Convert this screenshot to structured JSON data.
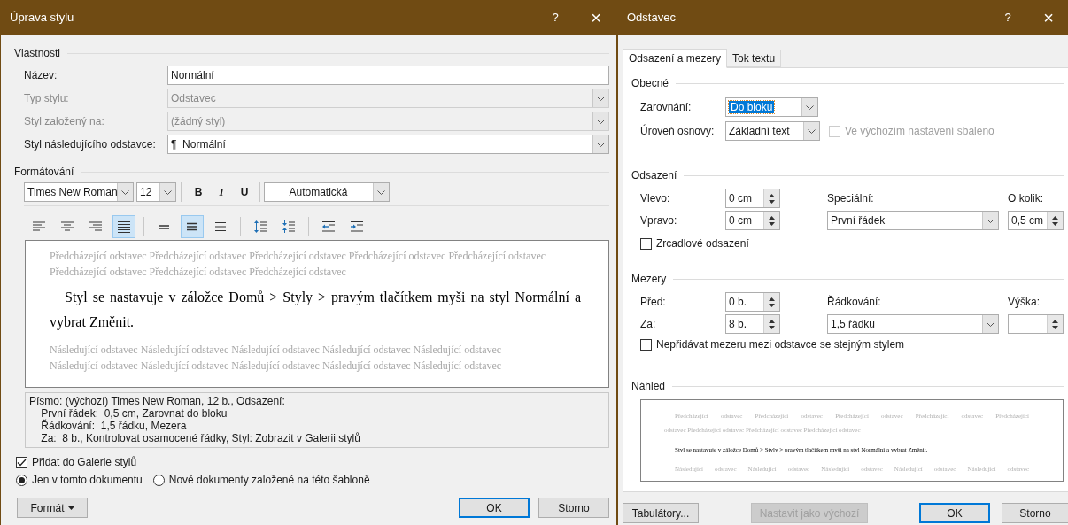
{
  "style_dialog": {
    "title": "Úprava stylu",
    "help": "?",
    "close": "×",
    "properties": {
      "heading": "Vlastnosti",
      "fields": [
        {
          "label": "Název:",
          "value": "Normální",
          "kind": "text",
          "disabled": false
        },
        {
          "label": "Typ stylu:",
          "value": "Odstavec",
          "kind": "select",
          "disabled": true
        },
        {
          "label": "Styl založený na:",
          "value": "(žádný styl)",
          "kind": "select",
          "disabled": true
        },
        {
          "label": "Styl následujícího odstavce:",
          "value": "¶  Normální",
          "kind": "select",
          "disabled": false
        }
      ]
    },
    "formatting": {
      "heading": "Formátování",
      "font": "Times New Roman",
      "size": "12",
      "bold": "B",
      "italic": "I",
      "underline": "U",
      "font_color_label": "Automatická",
      "paragraph_groups": [
        [
          {
            "kind": "align-left",
            "selected": false
          },
          {
            "kind": "align-center",
            "selected": false
          },
          {
            "kind": "align-right",
            "selected": false
          },
          {
            "kind": "justify",
            "selected": true
          }
        ],
        [
          {
            "kind": "single-spacing",
            "selected": false
          },
          {
            "kind": "one-half-spacing",
            "selected": true
          },
          {
            "kind": "double-spacing",
            "selected": false
          }
        ],
        [
          {
            "kind": "increase-spacing",
            "selected": false
          },
          {
            "kind": "decrease-spacing",
            "selected": false
          }
        ],
        [
          {
            "kind": "decrease-indent",
            "selected": false
          },
          {
            "kind": "increase-indent",
            "selected": false
          }
        ]
      ]
    },
    "preview": {
      "previous": [
        "Předcházející odstavec Předcházející odstavec Předcházející odstavec Předcházející odstavec Předcházející odstavec",
        "Předcházející odstavec Předcházející odstavec Předcházející odstavec"
      ],
      "text": "Styl se nastavuje v záložce Domů > Styly > pravým tlačítkem myši na styl Normální a vybrat Změnit.",
      "following": [
        "Následující odstavec Následující odstavec Následující odstavec Následující odstavec Následující odstavec",
        "Následující odstavec Následující odstavec Následující odstavec Následující odstavec Následující odstavec"
      ]
    },
    "description": [
      "Písmo: (výchozí) Times New Roman, 12 b., Odsazení:",
      "    První řádek:  0,5 cm, Zarovnat do bloku",
      "    Řádkování:  1,5 řádku, Mezera",
      "    Za:  8 b., Kontrolovat osamocené řádky, Styl: Zobrazit v Galerii stylů"
    ],
    "add_to_gallery": {
      "label": "Přidat do Galerie stylů",
      "checked": true
    },
    "scope": [
      {
        "label": "Jen v tomto dokumentu",
        "selected": true
      },
      {
        "label": "Nové dokumenty založené na této šabloně",
        "selected": false
      }
    ],
    "buttons": [
      {
        "label": "Formát",
        "kind": "menu"
      },
      {
        "label": "OK",
        "kind": "default"
      },
      {
        "label": "Storno",
        "kind": "normal"
      }
    ]
  },
  "paragraph_dialog": {
    "title": "Odstavec",
    "help": "?",
    "close": "×",
    "tabs": [
      {
        "label": "Odsazení a mezery",
        "selected": true
      },
      {
        "label": "Tok textu",
        "selected": false
      }
    ],
    "general": {
      "heading": "Obecné",
      "alignment": {
        "label": "Zarovnání:",
        "value": "Do bloku",
        "focused": true
      },
      "outline": {
        "label": "Úroveň osnovy:",
        "value": "Základní text",
        "focused": false
      },
      "collapsed": {
        "label": "Ve výchozím nastavení sbaleno",
        "checked": false,
        "disabled": true
      }
    },
    "indentation": {
      "heading": "Odsazení",
      "left": {
        "label": "Vlevo:",
        "value": "0 cm"
      },
      "right": {
        "label": "Vpravo:",
        "value": "0 cm"
      },
      "special": {
        "label": "Speciální:",
        "value": "První řádek"
      },
      "by": {
        "label": "O kolik:",
        "value": "0,5 cm"
      },
      "mirror": {
        "label": "Zrcadlové odsazení",
        "checked": false,
        "disabled": false
      }
    },
    "spacing": {
      "heading": "Mezery",
      "before": {
        "label": "Před:",
        "value": "0 b."
      },
      "after": {
        "label": "Za:",
        "value": "8 b."
      },
      "line_spacing": {
        "label": "Řádkování:",
        "value": "1,5 řádku"
      },
      "at": {
        "label": "Výška:"
      },
      "no_space": {
        "label": "Nepřidávat mezeru mezi odstavce se stejným stylem",
        "checked": false,
        "disabled": false
      }
    },
    "preview": {
      "heading": "Náhled",
      "previous": [
        "Předcházející odstavec Předcházející odstavec Předcházející odstavec Předcházející odstavec Předcházející",
        "odstavec Předcházející odstavec Předcházející odstavec Předcházející odstavec"
      ],
      "text": "Styl se nastavuje v záložce Domů > Styly > pravým tlačítkem myši na styl Normální a vybrat Změnit.",
      "following": [
        "Následující odstavec Následující odstavec Následující odstavec Následující odstavec Následující odstavec"
      ]
    },
    "buttons": [
      {
        "label": "Tabulátory...",
        "kind": "normal",
        "disabled": false
      },
      {
        "label": "Nastavit jako výchozí",
        "kind": "normal",
        "disabled": true
      },
      {
        "label": "OK",
        "kind": "default",
        "disabled": false
      },
      {
        "label": "Storno",
        "kind": "normal",
        "disabled": false
      }
    ]
  }
}
